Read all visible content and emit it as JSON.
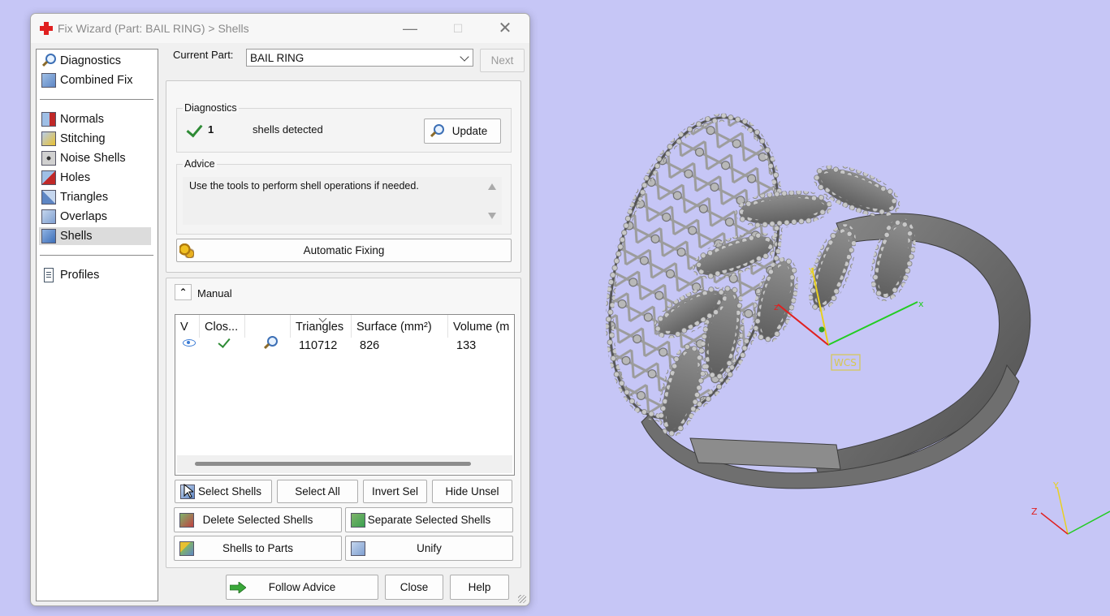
{
  "window": {
    "title": "Fix Wizard (Part: BAIL RING) > Shells",
    "controls": {
      "minimize": "—",
      "maximize": "☐",
      "close": "✕"
    }
  },
  "sidebar": {
    "items": [
      {
        "label": "Diagnostics",
        "icon": "magnifier-icon"
      },
      {
        "label": "Combined Fix",
        "icon": "cube-icon"
      },
      {
        "label": "Normals",
        "icon": "normals-cube-icon"
      },
      {
        "label": "Stitching",
        "icon": "stitching-cube-icon"
      },
      {
        "label": "Noise Shells",
        "icon": "noise-shells-icon"
      },
      {
        "label": "Holes",
        "icon": "holes-cube-icon"
      },
      {
        "label": "Triangles",
        "icon": "triangles-icon"
      },
      {
        "label": "Overlaps",
        "icon": "overlaps-cube-icon"
      },
      {
        "label": "Shells",
        "icon": "shells-cube-icon"
      },
      {
        "label": "Profiles",
        "icon": "document-icon"
      }
    ],
    "active": "Shells"
  },
  "current_part": {
    "label": "Current Part:",
    "value": "BAIL RING",
    "next_label": "Next"
  },
  "diagnostics": {
    "section_label": "Diagnostics",
    "count": "1",
    "status_text": "shells detected",
    "update_label": "Update"
  },
  "advice": {
    "section_label": "Advice",
    "text": "Use the tools to perform shell operations if needed."
  },
  "automatic_fixing_label": "Automatic Fixing",
  "manual": {
    "label": "Manual",
    "columns": [
      "V",
      "Clos...",
      "",
      "Triangles",
      "Surface (mm²)",
      "Volume (m"
    ],
    "rows": [
      {
        "visible_icon": "eye-icon",
        "closed_icon": "check-icon",
        "inspect_icon": "magnifier-icon",
        "triangles": "110712",
        "surface": "826",
        "volume": "133"
      }
    ],
    "buttons": {
      "select_shells": "Select Shells",
      "select_all": "Select All",
      "invert_sel": "Invert Sel",
      "hide_unsel": "Hide Unsel",
      "delete_selected": "Delete Selected Shells",
      "separate_selected": "Separate Selected Shells",
      "shells_to_parts": "Shells to Parts",
      "unify": "Unify"
    }
  },
  "footer": {
    "follow_advice": "Follow Advice",
    "close": "Close",
    "help": "Help"
  },
  "viewport": {
    "wcs_label": "WCS",
    "axes": {
      "x": "x",
      "y": "y",
      "z": "z"
    },
    "corner_axes": {
      "y": "Y",
      "z": "Z"
    },
    "background": "#c6c6f6"
  },
  "colors": {
    "accent_check": "#2e8b35",
    "axis_x": "#22cc22",
    "axis_y": "#e8d020",
    "axis_z": "#e02020"
  }
}
